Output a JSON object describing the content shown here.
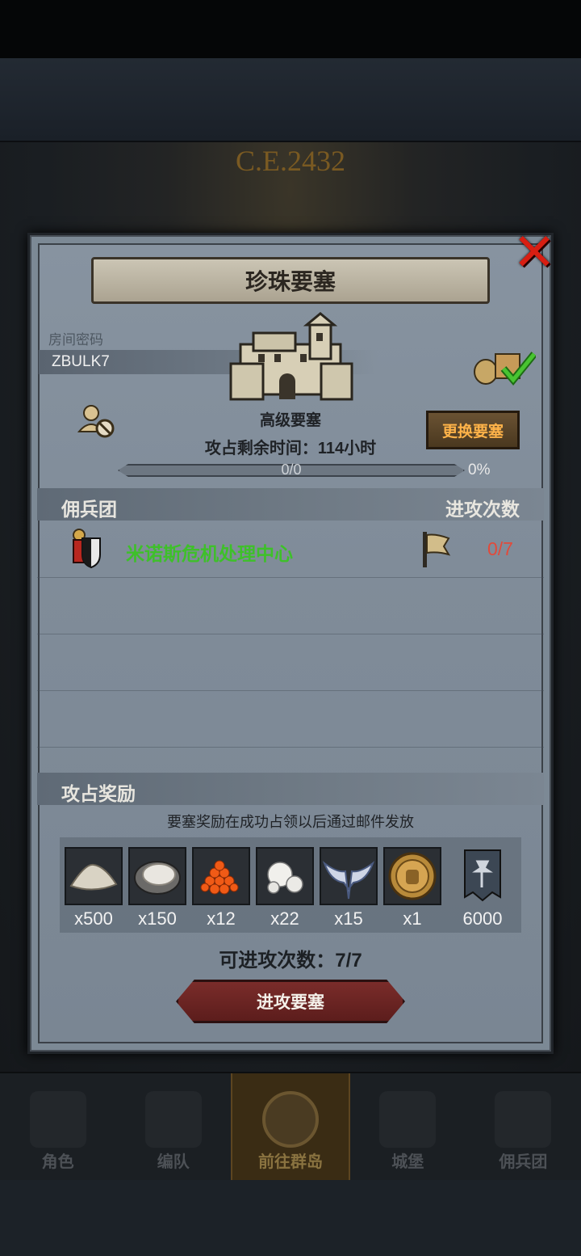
{
  "background": {
    "era_text": "C.E.2432",
    "nav": [
      {
        "label": "角色"
      },
      {
        "label": "编队"
      },
      {
        "label": "前往群岛"
      },
      {
        "label": "城堡"
      },
      {
        "label": "佣兵团"
      }
    ],
    "active_nav": "前往群岛"
  },
  "modal": {
    "title": "珍珠要塞",
    "room": {
      "label": "房间密码",
      "code": "ZBULK7"
    },
    "fortress_type": "高级要塞",
    "change_button": "更换要塞",
    "time_remaining": "攻占剩余时间：114小时",
    "progress": {
      "text": "0/0",
      "percent_label": "0%",
      "fraction": 0
    },
    "mercenary_section": {
      "left": "佣兵团",
      "right": "进攻次数"
    },
    "guilds": [
      {
        "name": "米诺斯危机处理中心",
        "attacks": "0/7",
        "name_color": "#3ec02a",
        "attacks_color": "#e24a3a"
      }
    ],
    "reward_section": {
      "title": "攻占奖励",
      "note": "要塞奖励在成功占领以后通过邮件发放"
    },
    "rewards": [
      {
        "icon": "sand-pile-icon",
        "qty": "x500"
      },
      {
        "icon": "oyster-icon",
        "qty": "x150"
      },
      {
        "icon": "fish-roe-icon",
        "qty": "x12"
      },
      {
        "icon": "pearls-icon",
        "qty": "x22"
      },
      {
        "icon": "winged-emblem-icon",
        "qty": "x15"
      },
      {
        "icon": "knight-medal-icon",
        "qty": "x1"
      },
      {
        "icon": "guild-banner-icon",
        "qty": "6000"
      }
    ],
    "attacks_available": "可进攻次数：7/7",
    "attack_button": "进攻要塞"
  }
}
